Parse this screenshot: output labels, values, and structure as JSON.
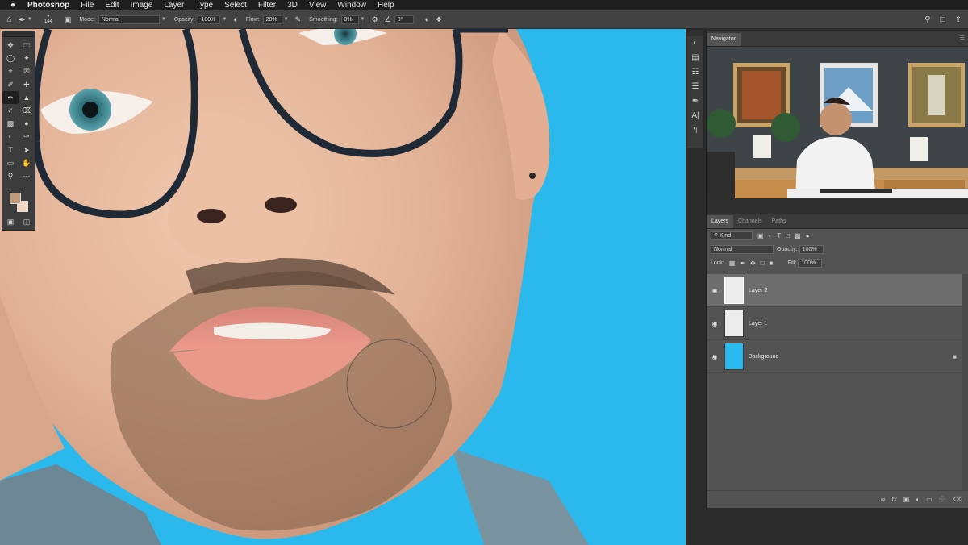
{
  "menubar": {
    "apple_icon": "apple-icon",
    "app_name": "Photoshop",
    "items": [
      "File",
      "Edit",
      "Image",
      "Layer",
      "Type",
      "Select",
      "Filter",
      "3D",
      "View",
      "Window",
      "Help"
    ]
  },
  "options_bar": {
    "brush_size": "144",
    "mode_label": "Mode:",
    "mode_value": "Normal",
    "opacity_label": "Opacity:",
    "opacity_value": "100%",
    "flow_label": "Flow:",
    "flow_value": "20%",
    "smoothing_label": "Smoothing:",
    "smoothing_value": "0%",
    "angle_value": "0°"
  },
  "navigator": {
    "tab": "Navigator"
  },
  "layers_panel": {
    "tabs": [
      "Layers",
      "Channels",
      "Paths"
    ],
    "filter_kind": "Kind",
    "blend_mode": "Normal",
    "opacity_label": "Opacity:",
    "opacity_value": "100%",
    "lock_label": "Lock:",
    "fill_label": "Fill:",
    "fill_value": "100%",
    "layers": [
      {
        "name": "Layer 2",
        "selected": true
      },
      {
        "name": "Layer 1",
        "selected": false
      },
      {
        "name": "Background",
        "selected": false,
        "locked": true
      }
    ]
  },
  "colors": {
    "foreground": "#c09a7c",
    "background": "#f2d7c2",
    "canvas_bg": "#2bb8ec",
    "panel_bg": "#535353"
  }
}
